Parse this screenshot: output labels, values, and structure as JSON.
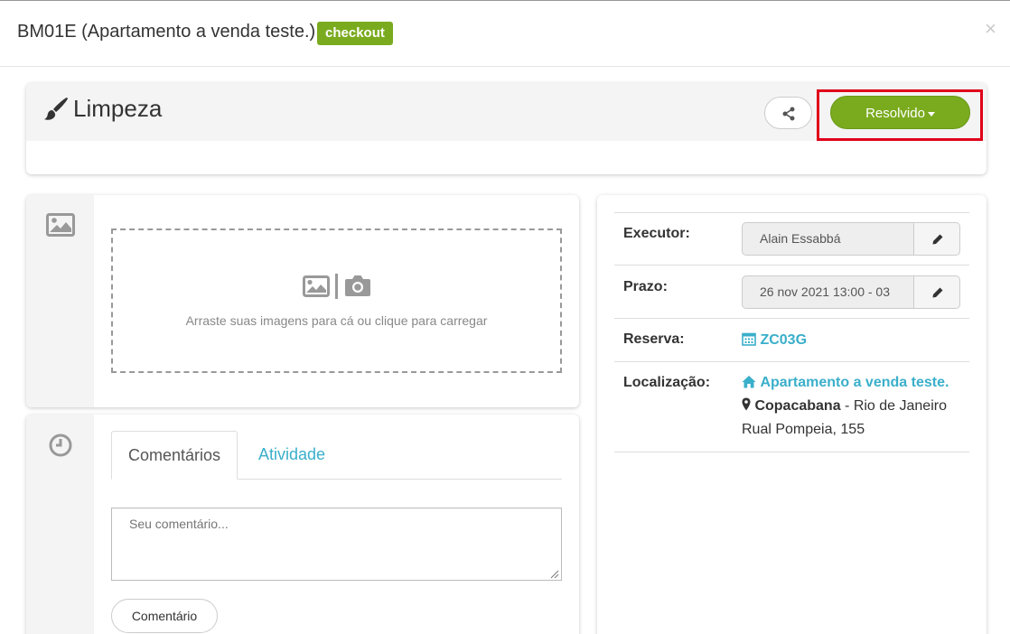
{
  "modal": {
    "title": "BM01E (Apartamento a venda teste.)",
    "badge": "checkout",
    "close": "×"
  },
  "task": {
    "icon": "paint-brush-icon",
    "title": "Limpeza",
    "share_icon": "share-icon",
    "status_label": "Resolvido",
    "status_color": "#7aab1f"
  },
  "upload": {
    "gutter_icon": "image-icon",
    "dropzone_text": "Arraste suas imagens para cá ou clique para carregar"
  },
  "comments": {
    "gutter_icon": "clock-icon",
    "tabs": [
      {
        "label": "Comentários",
        "active": true
      },
      {
        "label": "Atividade",
        "active": false
      }
    ],
    "placeholder": "Seu comentário...",
    "submit_label": "Comentário"
  },
  "details": {
    "executor_label": "Executor:",
    "executor_value": "Alain Essabbá",
    "deadline_label": "Prazo:",
    "deadline_value": "26 nov 2021 13:00 - 03",
    "reservation_label": "Reserva:",
    "reservation_value": "ZC03G",
    "location_label": "Localização:",
    "location_property": "Apartamento a venda teste.",
    "location_neighborhood": "Copacabana",
    "location_city": " - Rio de Janeiro",
    "location_address": "Rual Pompeia, 155"
  },
  "colors": {
    "accent_green": "#7aab1f",
    "link_blue": "#3aafca",
    "highlight_red": "#e0001a"
  }
}
